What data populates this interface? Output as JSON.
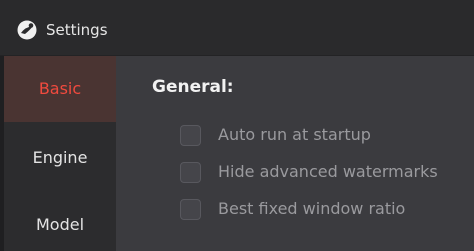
{
  "window": {
    "title": "Settings"
  },
  "sidebar": {
    "items": [
      {
        "label": "Basic",
        "active": true
      },
      {
        "label": "Engine",
        "active": false
      },
      {
        "label": "Model",
        "active": false
      }
    ]
  },
  "main": {
    "section_title": "General:",
    "options": [
      {
        "label": "Auto run at startup",
        "checked": false
      },
      {
        "label": "Hide advanced watermarks",
        "checked": false
      },
      {
        "label": "Best fixed window ratio",
        "checked": false
      }
    ]
  },
  "colors": {
    "accent": "#f04a3e",
    "active_bg": "#4a3432",
    "titlebar_bg": "#2a2a2c",
    "sidebar_bg": "#2c2c2e",
    "content_bg": "#3b3b3f"
  },
  "icons": {
    "app": "app-logo-icon",
    "checkbox": "checkbox-unchecked-icon"
  }
}
